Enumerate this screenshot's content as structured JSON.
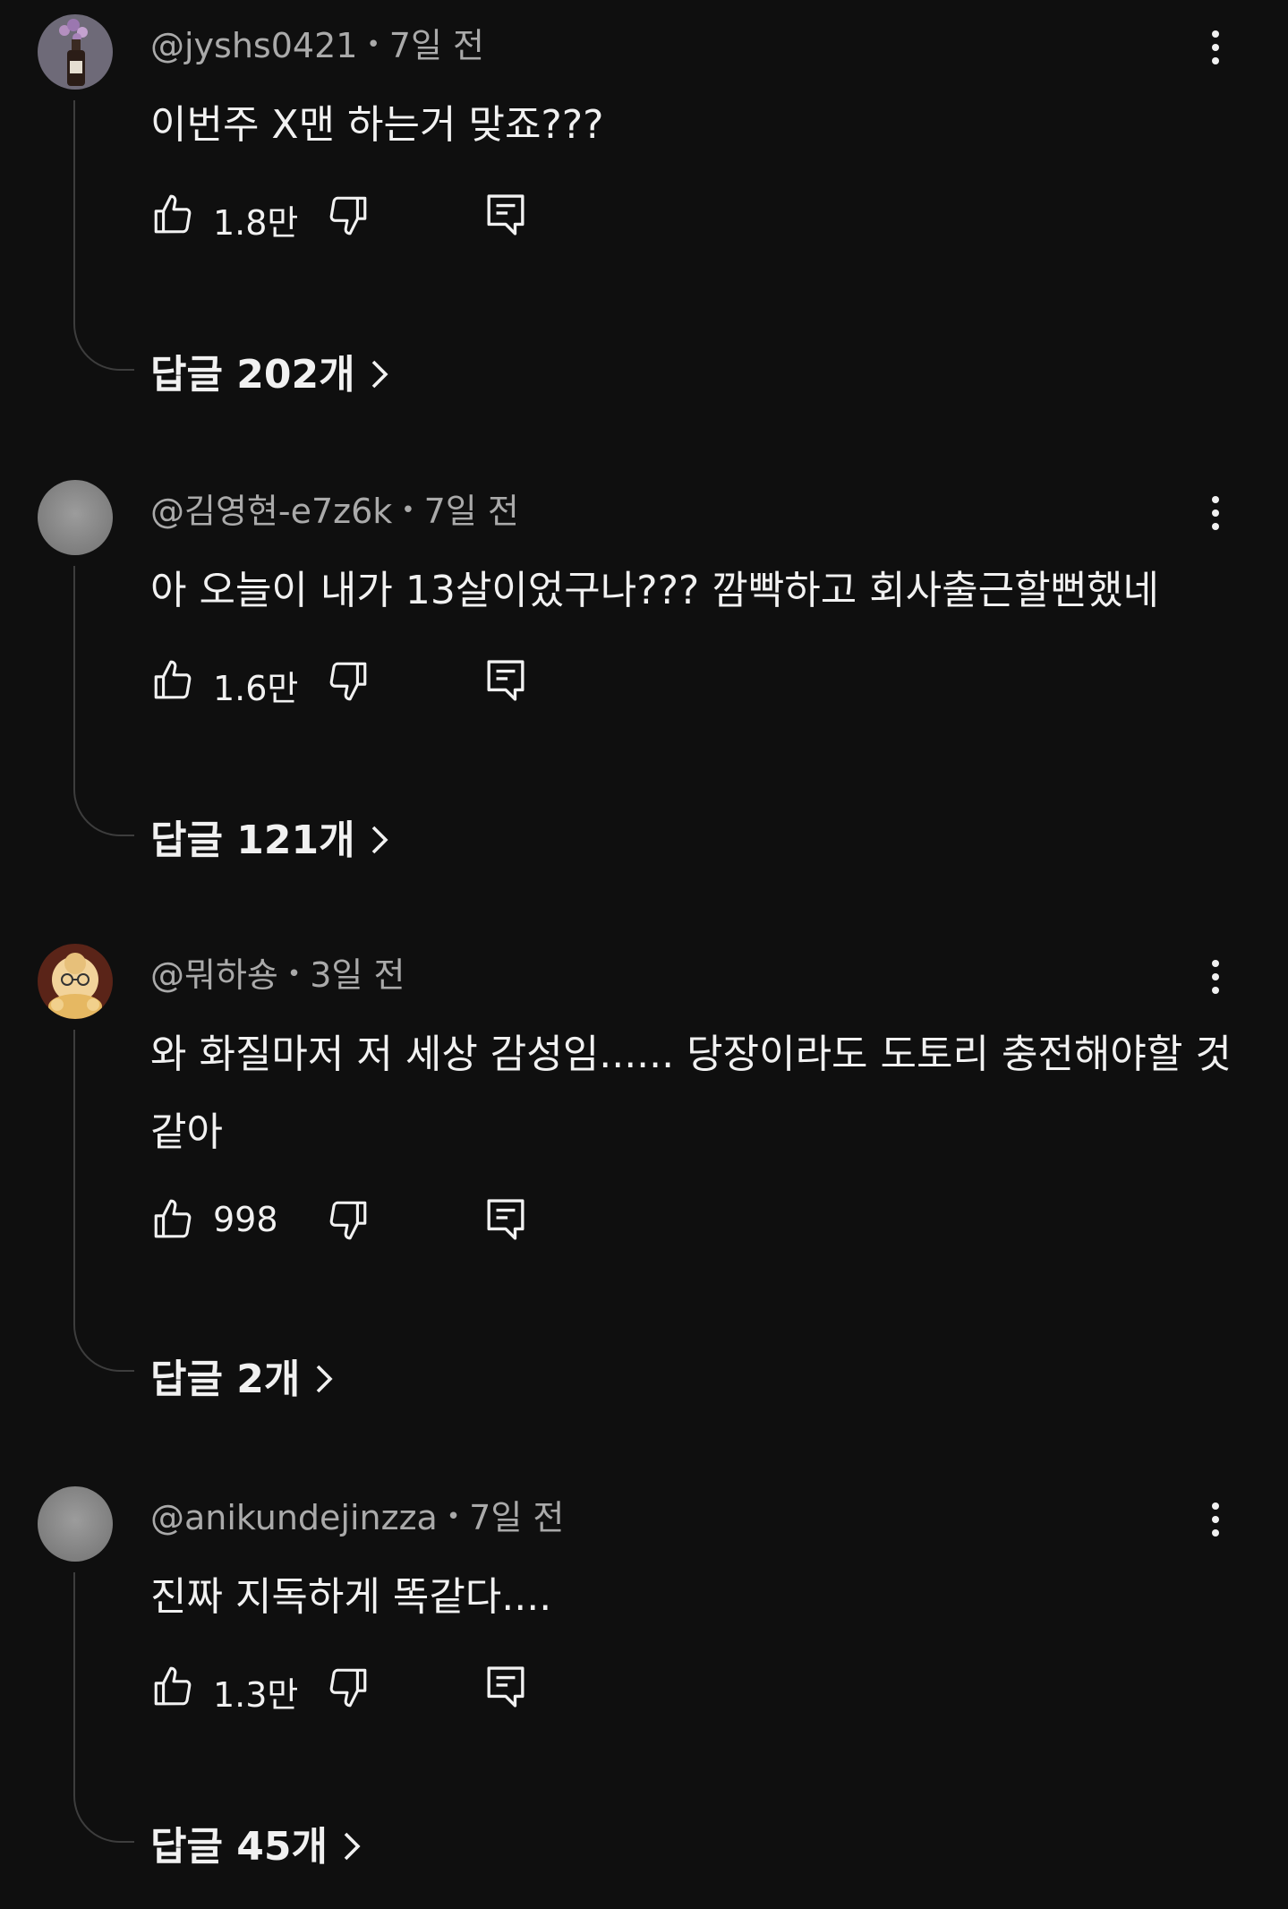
{
  "comments": [
    {
      "handle": "@jyshs0421",
      "time": "7일 전",
      "avatar": "avatar-wine-bottle",
      "text": "이번주 X맨 하는거 맞죠???",
      "likes": "1.8만",
      "replies": "답글 202개"
    },
    {
      "handle": "@김영현-e7z6k",
      "time": "7일 전",
      "avatar": "avatar-default-grey",
      "text": "아 오늘이 내가 13살이었구나??? 깜빡하고 회사출근할뻔했네",
      "likes": "1.6만",
      "replies": "답글 121개"
    },
    {
      "handle": "@뭐하숑",
      "time": "3일 전",
      "avatar": "avatar-cartoon-character",
      "text": "와 화질마저 저 세상 감성임...... 당장이라도 도토리 충전해야할 것 같아",
      "likes": "998",
      "replies": "답글 2개"
    },
    {
      "handle": "@anikundejinzza",
      "time": "7일 전",
      "avatar": "avatar-default-grey",
      "text": "진짜 지독하게 똑같다....",
      "likes": "1.3만",
      "replies": "답글 45개"
    }
  ],
  "colors": {
    "background": "#0f0f0f",
    "text_primary": "#f1f1f1",
    "text_secondary": "#aaaaaa",
    "thread_line": "#3d3d3d"
  },
  "icons": [
    "like-icon",
    "dislike-icon",
    "reply-icon",
    "more-options-icon",
    "chevron-right-icon"
  ]
}
